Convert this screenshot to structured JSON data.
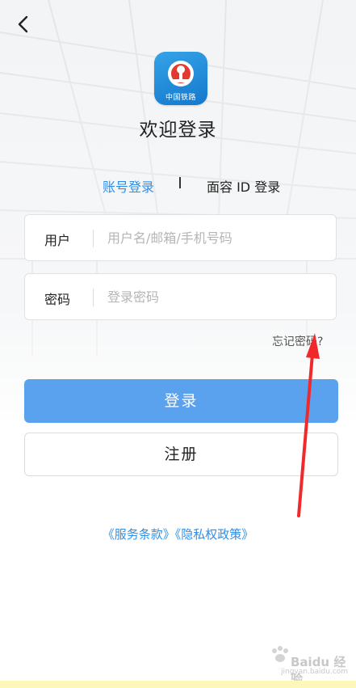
{
  "header": {
    "back_icon": "chevron-left-icon"
  },
  "logo": {
    "icon": "china-railway-logo",
    "text": "中国铁路",
    "color": "#1a84d8"
  },
  "title": "欢迎登录",
  "tabs": {
    "account": "账号登录",
    "face": "面容 ID 登录"
  },
  "form": {
    "user_label": "用户",
    "user_placeholder": "用户名/邮箱/手机号码",
    "password_label": "密码",
    "password_placeholder": "登录密码",
    "forgot": "忘记密码?"
  },
  "buttons": {
    "login": "登录",
    "register": "注册"
  },
  "links": {
    "terms": "《服务条款》",
    "privacy": "《隐私权政策》"
  },
  "colors": {
    "accent": "#2f8ee6",
    "login_button": "#5aa2ee",
    "annotation": "#f02a2a"
  },
  "watermark": {
    "text": "Baidu 经验",
    "sub": "jingyan.baidu.com"
  }
}
